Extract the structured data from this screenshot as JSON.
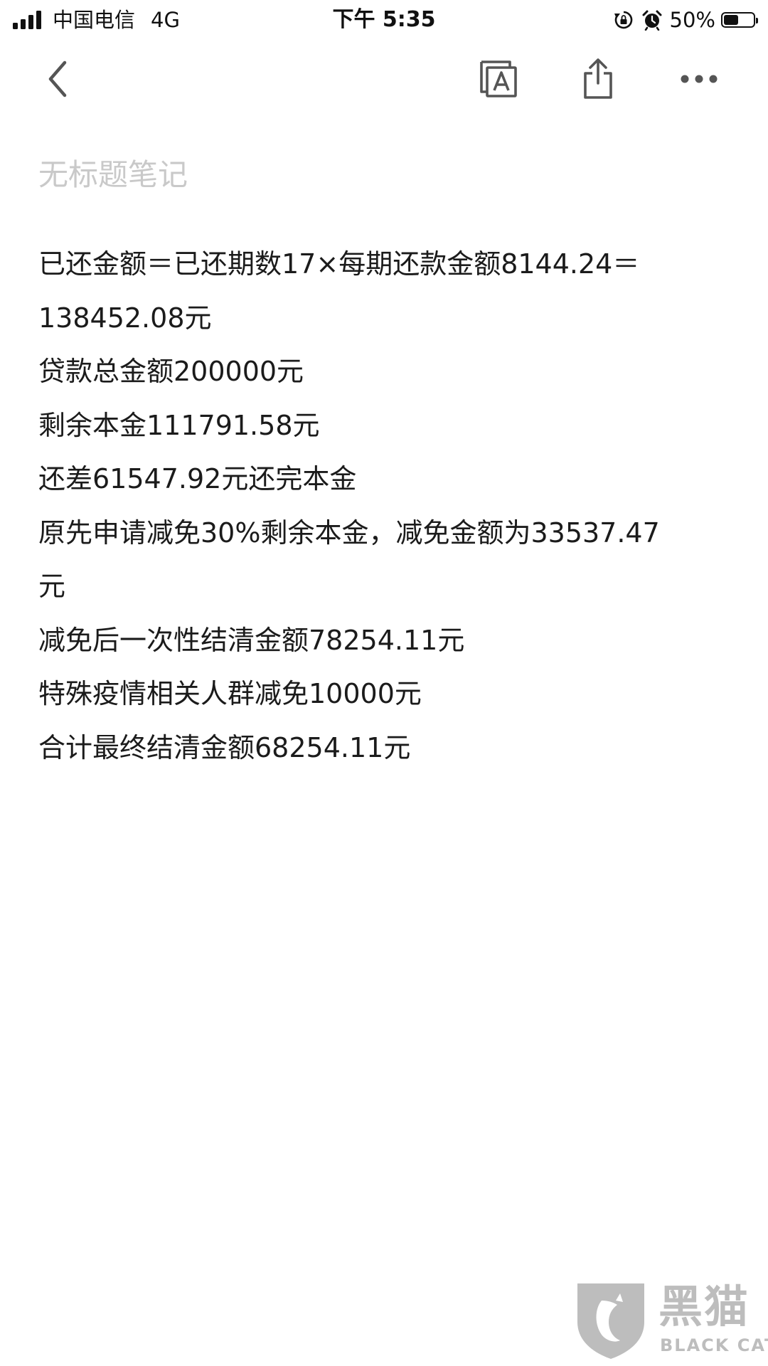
{
  "status_bar": {
    "carrier": "中国电信",
    "network": "4G",
    "time": "下午 5:35",
    "battery_percent_label": "50%",
    "battery_level": 0.5
  },
  "nav": {
    "icons": [
      "back-icon",
      "text-format-icon",
      "share-icon",
      "more-icon"
    ]
  },
  "note": {
    "title_placeholder": "无标题笔记",
    "lines": [
      "已还金额＝已还期数17×每期还款金额8144.24＝",
      "138452.08元",
      "贷款总金额200000元",
      "剩余本金111791.58元",
      "还差61547.92元还完本金",
      "原先申请减免30%剩余本金，减免金额为33537.47",
      "元",
      "减免后一次性结清金额78254.11元",
      "特殊疫情相关人群减免10000元",
      "合计最终结清金额68254.11元"
    ]
  },
  "watermark": {
    "name_cn": "黑猫",
    "name_en": "BLACK CAT"
  },
  "colors": {
    "text": "#1b1b1b",
    "placeholder": "#c9c9c9",
    "icon": "#555555",
    "watermark": "#bdbdbd",
    "background": "#ffffff"
  }
}
